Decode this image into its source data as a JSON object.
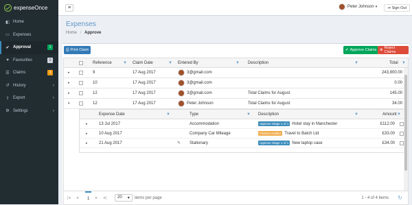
{
  "app": {
    "logo_text": "expenseOnce"
  },
  "sidebar": {
    "items": [
      {
        "label": "Home",
        "icon": "dashboard-icon"
      },
      {
        "label": "Expenses",
        "icon": "credit-card-icon"
      },
      {
        "label": "Approval",
        "icon": "check-icon",
        "badge": "1",
        "badge_color": "#00a65a"
      },
      {
        "label": "Favourites",
        "icon": "heart-icon",
        "badge": "0",
        "badge_color": "#d2d6de"
      },
      {
        "label": "Claims",
        "icon": "list-icon",
        "badge": "3",
        "badge_color": "#f39c12"
      },
      {
        "label": "History",
        "icon": "history-icon"
      },
      {
        "label": "Export",
        "icon": "share-icon"
      },
      {
        "label": "Settings",
        "icon": "gear-icon"
      }
    ]
  },
  "topbar": {
    "user_name": "Peter Johnson",
    "sign_out": "Sign Out"
  },
  "page": {
    "title": "Expenses",
    "breadcrumb_home": "Home",
    "breadcrumb_current": "Approve"
  },
  "toolbar": {
    "print_label": "Print Claim",
    "approve_label": "Approve Claims",
    "reject_label": "Reject Claims"
  },
  "grid": {
    "columns": [
      "Reference",
      "Claim Date",
      "Entered By",
      "Description",
      "Total"
    ],
    "rows": [
      {
        "reference": "9",
        "date": "17 Aug 2017",
        "entered_by": "3@gmail.com",
        "description": "",
        "total": "243,900.00"
      },
      {
        "reference": "10",
        "date": "17 Aug 2017",
        "entered_by": "3@gmail.com",
        "description": "",
        "total": "0.00"
      },
      {
        "reference": "12",
        "date": "17 Aug 2017",
        "entered_by": "3@gmail.com",
        "description": "Total Claims for August",
        "total": "145.00"
      },
      {
        "reference": "12",
        "date": "17 Aug 2017",
        "entered_by": "Peter Johnson",
        "description": "Total Claims for August",
        "total": "34.00"
      }
    ]
  },
  "subgrid": {
    "columns": [
      "Expense Date",
      "Type",
      "Description",
      "Amount"
    ],
    "rows": [
      {
        "date": "13 Jul 2017",
        "type": "Accommodation",
        "tag": "Approve Stage 1 of 1",
        "tag_color": "#3c8dbc",
        "description": "Hotel stay in Manchester",
        "amount": "£112.00"
      },
      {
        "date": "10 Aug 2017",
        "type": "Company Car Mileage",
        "tag": "Finance Auditor",
        "tag_color": "#f0ad4e",
        "description": "Travel to Batch Ltd",
        "amount": "£33.00"
      },
      {
        "date": "21 Aug 2017",
        "type": "Stationary",
        "tag": "Approve Stage 1 of 1",
        "tag_color": "#3c8dbc",
        "description": "New laptop case",
        "amount": "£34.00"
      }
    ]
  },
  "pager": {
    "current_page": "1",
    "page_size": "20",
    "items_per_page": "items per page",
    "summary": "1 - 4 of 4 items"
  }
}
